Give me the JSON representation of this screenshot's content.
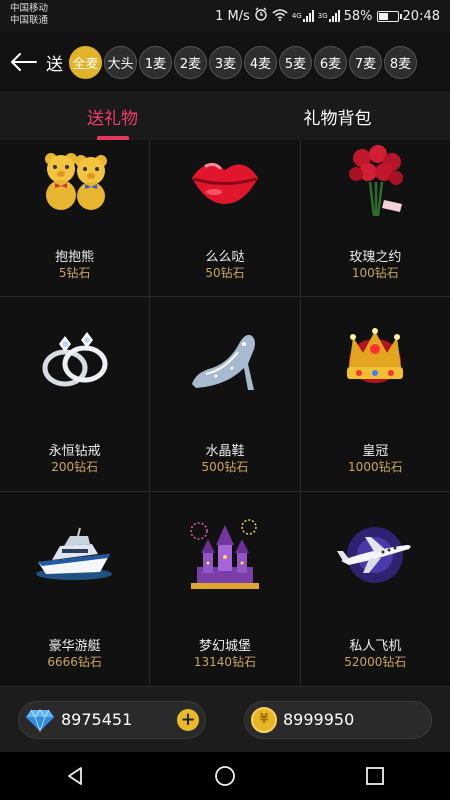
{
  "status_bar": {
    "carrier_1": "中国移动",
    "carrier_2": "中国联通",
    "speed": "1 M/s",
    "network_4g": "4G",
    "network_3g": "3G",
    "battery_text": "58%",
    "battery_level": 0.58,
    "time": "20:48"
  },
  "top_bar": {
    "send_label": "送",
    "mics": [
      {
        "label": "全麦",
        "active": true
      },
      {
        "label": "大头"
      },
      {
        "label": "1麦"
      },
      {
        "label": "2麦"
      },
      {
        "label": "3麦"
      },
      {
        "label": "4麦"
      },
      {
        "label": "5麦"
      },
      {
        "label": "6麦"
      },
      {
        "label": "7麦"
      },
      {
        "label": "8麦"
      }
    ]
  },
  "tabs": [
    {
      "label": "送礼物",
      "active": true
    },
    {
      "label": "礼物背包"
    }
  ],
  "gifts": [
    {
      "name": "抱抱熊",
      "price": "5钻石",
      "icon": "teddy-bears-icon"
    },
    {
      "name": "么么哒",
      "price": "50钻石",
      "icon": "kiss-lips-icon"
    },
    {
      "name": "玫瑰之约",
      "price": "100钻石",
      "icon": "rose-bouquet-icon"
    },
    {
      "name": "永恒钻戒",
      "price": "200钻石",
      "icon": "diamond-rings-icon"
    },
    {
      "name": "水晶鞋",
      "price": "500钻石",
      "icon": "crystal-shoe-icon"
    },
    {
      "name": "皇冠",
      "price": "1000钻石",
      "icon": "crown-icon"
    },
    {
      "name": "豪华游艇",
      "price": "6666钻石",
      "icon": "yacht-icon"
    },
    {
      "name": "梦幻城堡",
      "price": "13140钻石",
      "icon": "castle-icon"
    },
    {
      "name": "私人飞机",
      "price": "52000钻石",
      "icon": "private-jet-icon"
    }
  ],
  "balance": {
    "diamonds": "8975451",
    "coins": "8999950",
    "coin_symbol": "¥"
  }
}
